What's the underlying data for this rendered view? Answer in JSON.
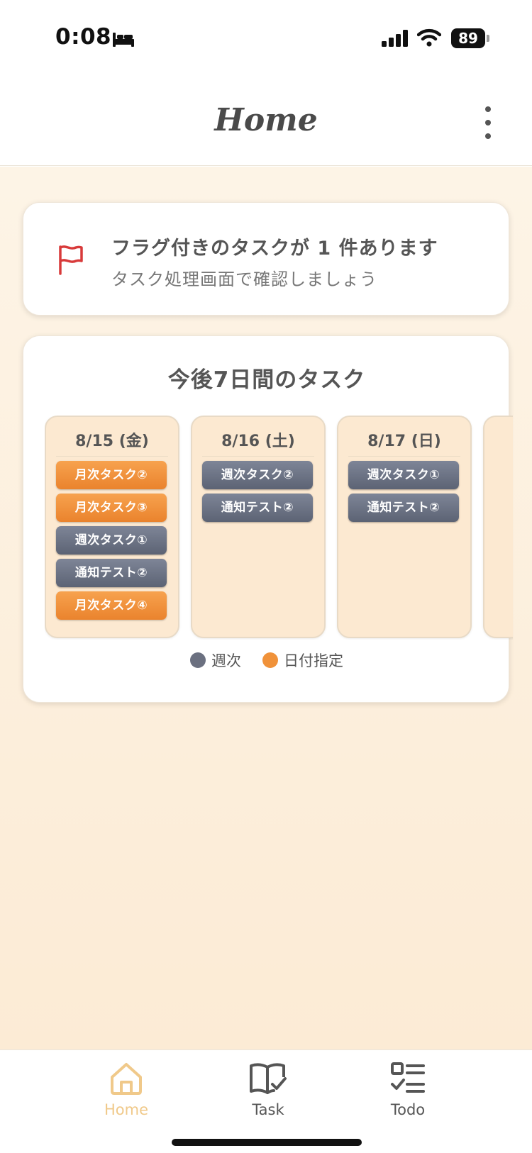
{
  "status_bar": {
    "time": "0:08",
    "battery": "89"
  },
  "header": {
    "title": "Home"
  },
  "flag_card": {
    "title": "フラグ付きのタスクが 1 件あります",
    "subtitle": "タスク処理画面で確認しましょう"
  },
  "week_card": {
    "title": "今後7日間のタスク",
    "days": [
      {
        "date": "8/15 (金)",
        "tasks": [
          {
            "label": "月次タスク②",
            "type": "dated"
          },
          {
            "label": "月次タスク③",
            "type": "dated"
          },
          {
            "label": "週次タスク①",
            "type": "weekly"
          },
          {
            "label": "通知テスト②",
            "type": "weekly"
          },
          {
            "label": "月次タスク④",
            "type": "dated"
          }
        ]
      },
      {
        "date": "8/16 (土)",
        "tasks": [
          {
            "label": "週次タスク②",
            "type": "weekly"
          },
          {
            "label": "通知テスト②",
            "type": "weekly"
          }
        ]
      },
      {
        "date": "8/17 (日)",
        "tasks": [
          {
            "label": "週次タスク①",
            "type": "weekly"
          },
          {
            "label": "通知テスト②",
            "type": "weekly"
          }
        ]
      }
    ],
    "legend": [
      {
        "label": "週次",
        "color": "#6b7080"
      },
      {
        "label": "日付指定",
        "color": "#f0923a"
      }
    ]
  },
  "tabs": [
    {
      "label": "Home",
      "icon": "home-icon",
      "active": true,
      "color": "#f0c98a"
    },
    {
      "label": "Task",
      "icon": "book-check-icon",
      "active": false,
      "color": "#555555"
    },
    {
      "label": "Todo",
      "icon": "checklist-icon",
      "active": false,
      "color": "#555555"
    }
  ],
  "colors": {
    "weekly": "#6b7080",
    "dated": "#f0923a",
    "flag": "#d83a3a",
    "background": "#fdf0de"
  }
}
